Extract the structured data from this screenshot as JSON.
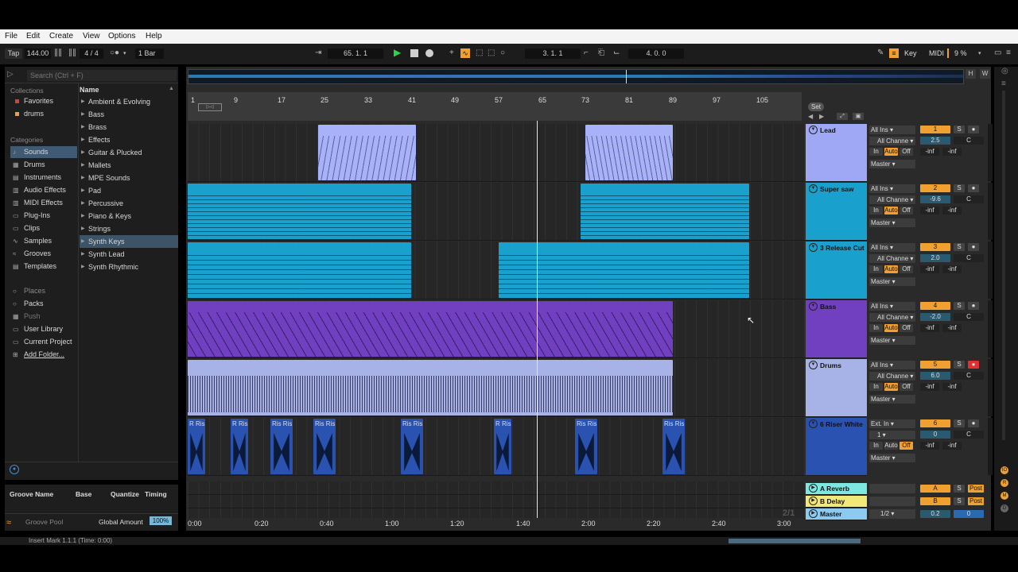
{
  "menu": [
    "File",
    "Edit",
    "Create",
    "View",
    "Options",
    "Help"
  ],
  "control": {
    "tap": "Tap",
    "tempo": "144.00",
    "signature": "4 / 4",
    "quantize": "1 Bar",
    "position": "65.  1.  1",
    "loop_start": "3.  1.  1",
    "loop_length": "4.  0.  0",
    "key": "Key",
    "midi": "MIDI",
    "cpu": "9 %"
  },
  "browser": {
    "search_placeholder": "Search (Ctrl + F)",
    "collections_header": "Collections",
    "collections": [
      {
        "label": "Favorites",
        "color": "#e23b3b"
      },
      {
        "label": "drums",
        "color": "#f0a030"
      }
    ],
    "categories_header": "Categories",
    "categories": [
      "Sounds",
      "Drums",
      "Instruments",
      "Audio Effects",
      "MIDI Effects",
      "Plug-Ins",
      "Clips",
      "Samples",
      "Grooves",
      "Templates"
    ],
    "selected_category": "Sounds",
    "places_header": "Places",
    "places": [
      "Packs",
      "Push",
      "User Library",
      "Current Project",
      "Add Folder..."
    ],
    "name_header": "Name",
    "items": [
      "Ambient & Evolving",
      "Bass",
      "Brass",
      "Effects",
      "Guitar & Plucked",
      "Mallets",
      "MPE Sounds",
      "Pad",
      "Percussive",
      "Piano & Keys",
      "Strings",
      "Synth Keys",
      "Synth Lead",
      "Synth Rhythmic"
    ],
    "selected_item": "Synth Keys"
  },
  "groove": {
    "col_name": "Groove Name",
    "col_base": "Base",
    "col_quantize": "Quantize",
    "col_timing": "Timing",
    "pool": "Groove Pool",
    "global_amount_label": "Global Amount",
    "global_amount": "100%"
  },
  "ruler": {
    "bars": [
      "1",
      "9",
      "17",
      "25",
      "33",
      "41",
      "49",
      "57",
      "65",
      "73",
      "81",
      "89",
      "97",
      "105"
    ],
    "set_label": "Set"
  },
  "timeline": [
    "0:00",
    "0:20",
    "0:40",
    "1:00",
    "1:20",
    "1:40",
    "2:00",
    "2:20",
    "2:40",
    "3:00"
  ],
  "tracks": [
    {
      "name": "Lead",
      "color": "#9ea8f5",
      "input": "All Ins",
      "channel": "All Channe",
      "monitor": [
        "In",
        "Auto",
        "Off"
      ],
      "output": "Master",
      "num": "1",
      "volume": "2.5",
      "pan": "C",
      "sends": [
        "-inf",
        "-inf"
      ],
      "armed": false
    },
    {
      "name": "Super saw",
      "color": "#1aa0cc",
      "input": "All Ins",
      "channel": "All Channe",
      "monitor": [
        "In",
        "Auto",
        "Off"
      ],
      "output": "Master",
      "num": "2",
      "volume": "-9.6",
      "pan": "C",
      "sends": [
        "-inf",
        "-inf"
      ],
      "armed": false
    },
    {
      "name": "3 Release Cut",
      "color": "#1aa0cc",
      "input": "All Ins",
      "channel": "All Channe",
      "monitor": [
        "In",
        "Auto",
        "Off"
      ],
      "output": "Master",
      "num": "3",
      "volume": "2.0",
      "pan": "C",
      "sends": [
        "-inf",
        "-inf"
      ],
      "armed": false
    },
    {
      "name": "Bass",
      "color": "#7040c0",
      "input": "All Ins",
      "channel": "All Channe",
      "monitor": [
        "In",
        "Auto",
        "Off"
      ],
      "output": "Master",
      "num": "4",
      "volume": "-2.0",
      "pan": "C",
      "sends": [
        "-inf",
        "-inf"
      ],
      "armed": false
    },
    {
      "name": "Drums",
      "color": "#a7b2e6",
      "input": "All Ins",
      "channel": "All Channe",
      "monitor": [
        "In",
        "Auto",
        "Off"
      ],
      "output": "Master",
      "num": "5",
      "volume": "6.0",
      "pan": "C",
      "sends": [
        "-inf",
        "-inf"
      ],
      "armed": true
    },
    {
      "name": "6 Riser White",
      "color": "#2a52b0",
      "input": "Ext. In",
      "channel": "1",
      "monitor": [
        "In",
        "Auto",
        "Off"
      ],
      "output": "Master",
      "num": "6",
      "volume": "0",
      "pan": "C",
      "sends": [
        "-inf",
        "-inf"
      ],
      "armed": false
    }
  ],
  "returns": [
    {
      "name": "A Reverb",
      "color": "#7ce8e0",
      "letter": "A",
      "solo": "S",
      "mode": "Post"
    },
    {
      "name": "B Delay",
      "color": "#f0e878",
      "letter": "B",
      "solo": "S",
      "mode": "Post"
    }
  ],
  "master": {
    "name": "Master",
    "color": "#8ccaf0",
    "output": "1/2",
    "volume": "0.2",
    "pan": "0"
  },
  "riser_clip_labels": [
    "R Ris",
    "R Ris",
    "Ris Ris",
    "Ris Ris",
    "Ris Ris",
    "R Ris",
    "Ris Ris",
    "Ris Ris"
  ],
  "page_indicator": "2/1",
  "status": "Insert Mark 1.1.1 (Time: 0:00)",
  "overview_buttons": [
    "H",
    "W"
  ]
}
